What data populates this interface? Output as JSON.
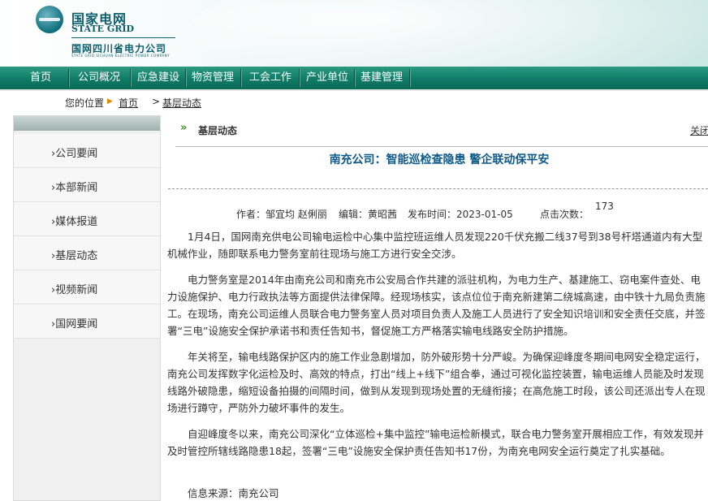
{
  "header": {
    "brand_cn": "国家电网",
    "brand_en": "STATE GRID",
    "company_cn": "国网四川省电力公司",
    "company_en": "STATE GRID SICHUAN ELECTRIC POWER COMPANY"
  },
  "nav": {
    "items": [
      "首页",
      "公司概况",
      "应急建设",
      "物资管理",
      "工会工作",
      "产业单位",
      "基建管理"
    ]
  },
  "breadcrumb": {
    "label": "您的位置",
    "home": "首页",
    "separator": ">",
    "current": "基层动态"
  },
  "sidebar": {
    "items": [
      "公司要闻",
      "本部新闻",
      "媒体报道",
      "基层动态",
      "视频新闻",
      "国网要闻"
    ]
  },
  "section": {
    "title": "基层动态",
    "close_label": "关闭"
  },
  "article": {
    "title": "南充公司：智能巡检查隐患 警企联动保平安",
    "author": "作者：邹宜均 赵俐丽",
    "editor": "编辑：黄昭茜",
    "publish_time": "发布时间：2023-01-05",
    "hits_label": "点击次数：",
    "hits_value": "173",
    "paragraphs": [
      "1月4日，国网南充供电公司输电运检中心集中监控班运维人员发现220千伏充搬二线37号到38号杆塔通道内有大型机械作业，随即联系电力警务室前往现场与施工方进行安全交涉。",
      "电力警务室是2014年由南充公司和南充市公安局合作共建的派驻机构，为电力生产、基建施工、窃电案件查处、电力设施保护、电力行政执法等方面提供法律保障。经现场核实，该点位位于南充新建第二绕城高速，由中铁十九局负责施工。在现场，南充公司运维人员联合电力警务室人员对项目负责人及施工人员进行了安全知识培训和安全责任交底，并签署“三电”设施安全保护承诺书和责任告知书，督促施工方严格落实输电线路安全防护措施。",
      "年关将至，输电线路保护区内的施工作业急剧增加，防外破形势十分严峻。为确保迎峰度冬期间电网安全稳定运行，南充公司发挥数字化运检及时、高效的特点，打出“线上+线下”组合拳，通过可视化监控装置，输电运维人员能及时发现线路外破隐患，缩短设备拍摄的间隔时间，做到从发现到现场处置的无缝衔接；在高危施工时段，该公司还派出专人在现场进行蹲守，严防外力破坏事件的发生。",
      "自迎峰度冬以来，南充公司深化“立体巡检+集中监控”输电运检新模式，联合电力警务室开展相应工作，有效发现并及时管控所辖线路隐患18起，签署“三电”设施安全保护责任告知书17份，为南充电网安全运行奠定了扎实基础。"
    ],
    "source": "信息来源：南充公司"
  }
}
